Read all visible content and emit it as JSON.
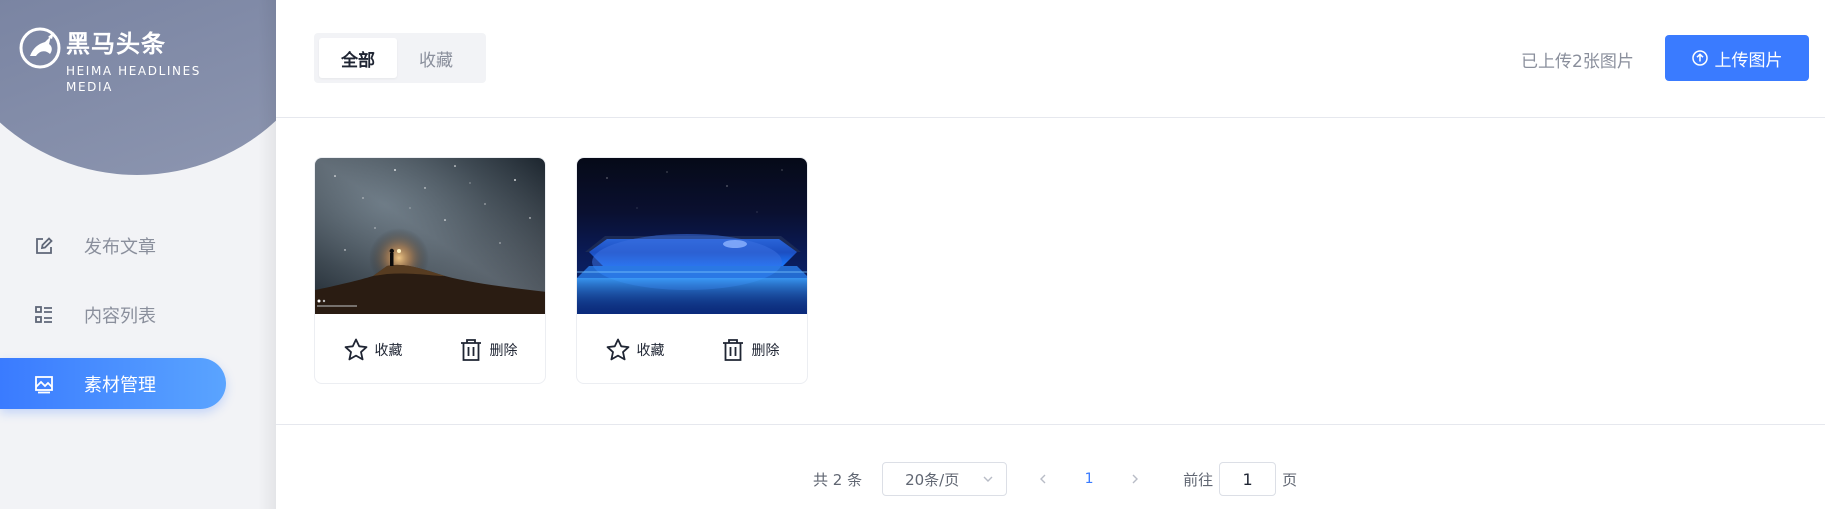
{
  "brand": {
    "name_cn": "黑马头条",
    "name_en": "HEIMA HEADLINES MEDIA",
    "icon": "horse-logo-icon"
  },
  "sidebar": {
    "items": [
      {
        "label": "发布文章",
        "icon": "edit-icon",
        "active": false
      },
      {
        "label": "内容列表",
        "icon": "list-icon",
        "active": false
      },
      {
        "label": "素材管理",
        "icon": "image-icon",
        "active": true
      }
    ]
  },
  "toolbar": {
    "tabs": [
      {
        "label": "全部",
        "active": true
      },
      {
        "label": "收藏",
        "active": false
      }
    ],
    "upload_count": "已上传2张图片",
    "upload_button_label": "上传图片",
    "upload_icon": "arrow-up-circle-icon"
  },
  "materials": [
    {
      "image": "night-sky-person-photo",
      "favorite_label": "收藏",
      "delete_label": "删除"
    },
    {
      "image": "blue-phone-display-photo",
      "favorite_label": "收藏",
      "delete_label": "删除"
    }
  ],
  "pagination": {
    "total": "共 2 条",
    "page_size": "20条/页",
    "current_page": "1",
    "goto_label": "前往",
    "goto_value": "1",
    "goto_suffix": "页"
  },
  "colors": {
    "accent": "#3a7bff",
    "sidebar_bg": "#f2f3f6",
    "logo_blob": "#7a84a2",
    "text_muted": "#8a8f9c",
    "text_dark": "#1f2533"
  }
}
